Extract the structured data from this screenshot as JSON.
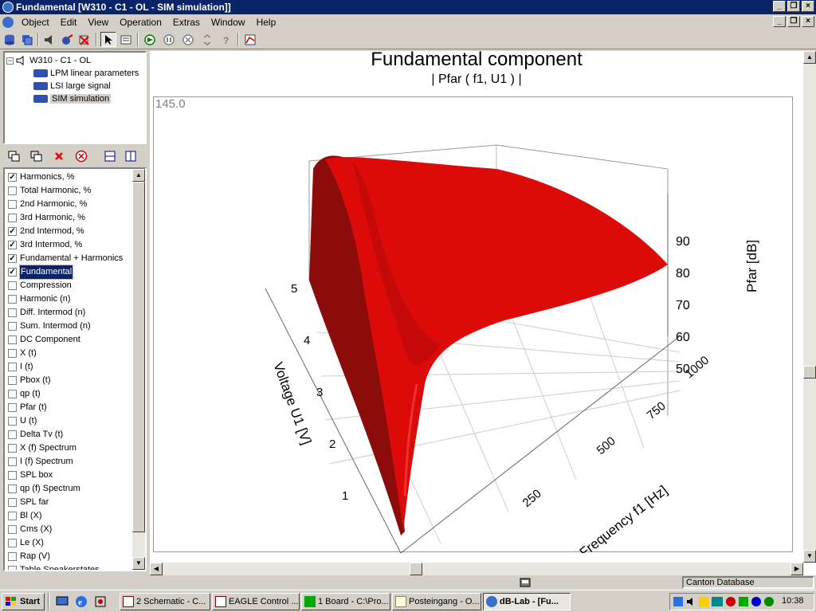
{
  "window": {
    "title": "Fundamental [W310 - C1 - OL - SIM simulation]]",
    "btn_min": "_",
    "btn_restore": "❐",
    "btn_close": "×"
  },
  "menu": [
    {
      "label": "Object"
    },
    {
      "label": "Edit"
    },
    {
      "label": "View"
    },
    {
      "label": "Operation"
    },
    {
      "label": "Extras"
    },
    {
      "label": "Window"
    },
    {
      "label": "Help"
    }
  ],
  "tree": {
    "root": "W310 - C1 - OL",
    "children": [
      "LPM linear parameters",
      "LSI large signal",
      "SIM simulation"
    ]
  },
  "list": [
    {
      "label": "Harmonics, %",
      "checked": true
    },
    {
      "label": "Total Harmonic, %",
      "checked": false
    },
    {
      "label": "2nd Harmonic, %",
      "checked": false
    },
    {
      "label": "3rd Harmonic, %",
      "checked": false
    },
    {
      "label": "2nd Intermod, %",
      "checked": true
    },
    {
      "label": "3rd Intermod, %",
      "checked": true
    },
    {
      "label": "Fundamental + Harmonics",
      "checked": true
    },
    {
      "label": "Fundamental",
      "checked": true
    },
    {
      "label": "Compression",
      "checked": false
    },
    {
      "label": "Harmonic (n)",
      "checked": false
    },
    {
      "label": "Diff. Intermod (n)",
      "checked": false
    },
    {
      "label": "Sum. Intermod (n)",
      "checked": false
    },
    {
      "label": "DC Component",
      "checked": false
    },
    {
      "label": "X (t)",
      "checked": false
    },
    {
      "label": "I (t)",
      "checked": false
    },
    {
      "label": "Pbox (t)",
      "checked": false
    },
    {
      "label": "qp (t)",
      "checked": false
    },
    {
      "label": "Pfar (t)",
      "checked": false
    },
    {
      "label": "U (t)",
      "checked": false
    },
    {
      "label": "Delta Tv (t)",
      "checked": false
    },
    {
      "label": "X (f) Spectrum",
      "checked": false
    },
    {
      "label": "I (f) Spectrum",
      "checked": false
    },
    {
      "label": "SPL box",
      "checked": false
    },
    {
      "label": "qp (f) Spectrum",
      "checked": false
    },
    {
      "label": "SPL far",
      "checked": false
    },
    {
      "label": "Bl (X)",
      "checked": false
    },
    {
      "label": "Cms (X)",
      "checked": false
    },
    {
      "label": "Le (X)",
      "checked": false
    },
    {
      "label": "Rap (V)",
      "checked": false
    },
    {
      "label": "Table Speakerstates",
      "checked": false
    }
  ],
  "selected_list_index": 7,
  "chart_data": {
    "type": "surface3d",
    "title": "Fundamental component",
    "subtitle": "|  Pfar ( f1, U1 )  |",
    "corner_value": "145.0",
    "xlabel": "Frequency f1  [Hz]",
    "ylabel": "Voltage U1  [V]",
    "zlabel": "Pfar [dB]",
    "x_ticks": [
      "250",
      "500",
      "750",
      "1000"
    ],
    "y_ticks": [
      "1",
      "2",
      "3",
      "4",
      "5"
    ],
    "z_ticks": [
      "50",
      "60",
      "70",
      "80",
      "90"
    ],
    "surface_color": "#dd0a0a",
    "shadow_color": "#8c0c0c"
  },
  "status": {
    "right_text": "Canton Database"
  },
  "taskbar": {
    "start": "Start",
    "tasks": [
      "2 Schematic - C...",
      "EAGLE Control ...",
      "1 Board - C:\\Pro...",
      "Posteingang - O...",
      "dB-Lab - [Fu..."
    ],
    "clock": "10:38"
  }
}
